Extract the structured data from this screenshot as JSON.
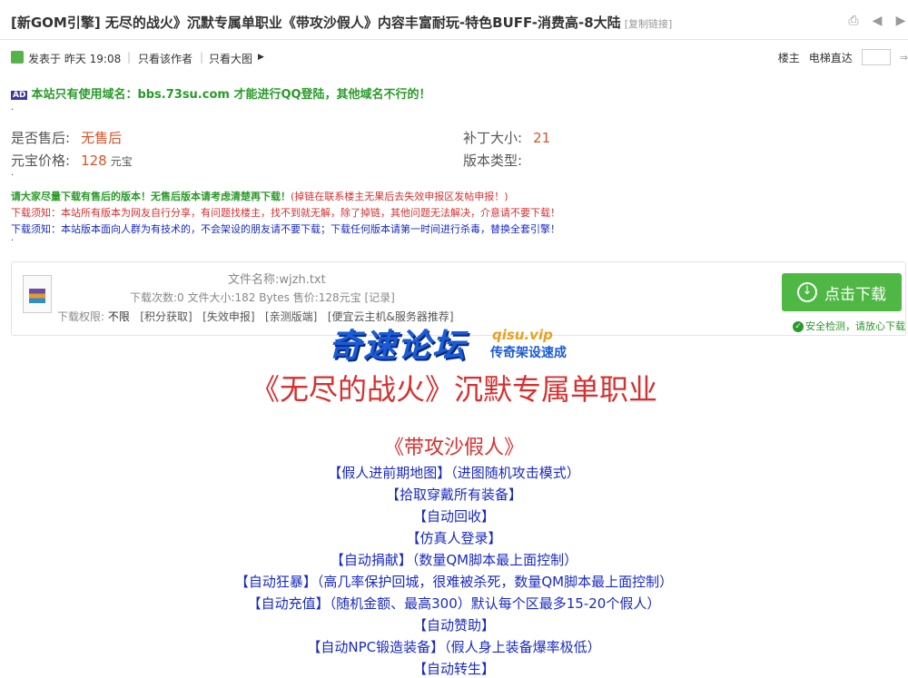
{
  "header": {
    "title": "[新GOM引擎] 无尽的战火》沉默专属单职业《带攻沙假人》内容丰富耐玩-特色BUFF-消费高-8大陆",
    "copy_link": "[复制链接]",
    "icons": [
      "print-icon",
      "prev-icon",
      "next-icon"
    ]
  },
  "meta": {
    "posted": "发表于 昨天 19:08",
    "author_only": "只看该作者",
    "big_image": "只看大图",
    "floor_owner": "楼主",
    "jump": "电梯直达"
  },
  "ad": {
    "badge": "AD",
    "text": "本站只有使用域名：bbs.73su.com 才能进行QQ登陆，其他域名不行的！"
  },
  "info": {
    "after_sale_label": "是否售后:",
    "after_sale_value": "无售后",
    "patch_label": "补丁大小:",
    "patch_value": "21",
    "price_label": "元宝价格:",
    "price_value": "128",
    "price_unit": "元宝",
    "type_label": "版本类型:"
  },
  "notices": {
    "line1": "请大家尽量下载有售后的版本！无售后版本请考虑清楚再下载！",
    "line1_red": "(掉链在联系楼主无果后去失效申报区发帖申报！)",
    "line2": "下载须知：本站所有版本为网友自行分享，有问题找楼主，找不到就无解，除了掉链，其他问题无法解决，介意请不要下载！",
    "line3": "下载须知：本站版本面向人群为有技术的，不会架设的朋友请不要下载；下载任何版本请第一时间进行杀毒，替换全套引擎！"
  },
  "attachment": {
    "file_name": "文件名称:wjzh.txt",
    "stats": "下载次数:0  文件大小:182 Bytes  售价:128元宝 [记录]",
    "perm_label": "下载权限:",
    "perm_value": "不限",
    "link_points": "[积分获取]",
    "link_invalid": "[失效申报]",
    "link_test": "[亲测版端]",
    "link_cloud": "[便宜云主机&服务器推荐]",
    "download_label": "点击下载",
    "safe_text": "安全检测，请放心下载"
  },
  "watermark": {
    "main": "奇速论坛",
    "site": "qisu.vip",
    "slogan": "传奇架设速成"
  },
  "content": {
    "title": "《无尽的战火》沉默专属单职业",
    "subtitle": "《带攻沙假人》",
    "features": [
      "【假人进前期地图】（进图随机攻击模式）",
      "【拾取穿戴所有装备】",
      "【自动回收】",
      "【仿真人登录】",
      "【自动捐献】（数量QM脚本最上面控制）",
      "【自动狂暴】（高几率保护回城，很难被杀死，数量QM脚本最上面控制）",
      "【自动充值】（随机金额、最高300）默认每个区最多15-20个假人）",
      "【自动赞助】",
      "【自动NPC锻造装备】（假人身上装备爆率极低）",
      "【自动转生】"
    ]
  }
}
